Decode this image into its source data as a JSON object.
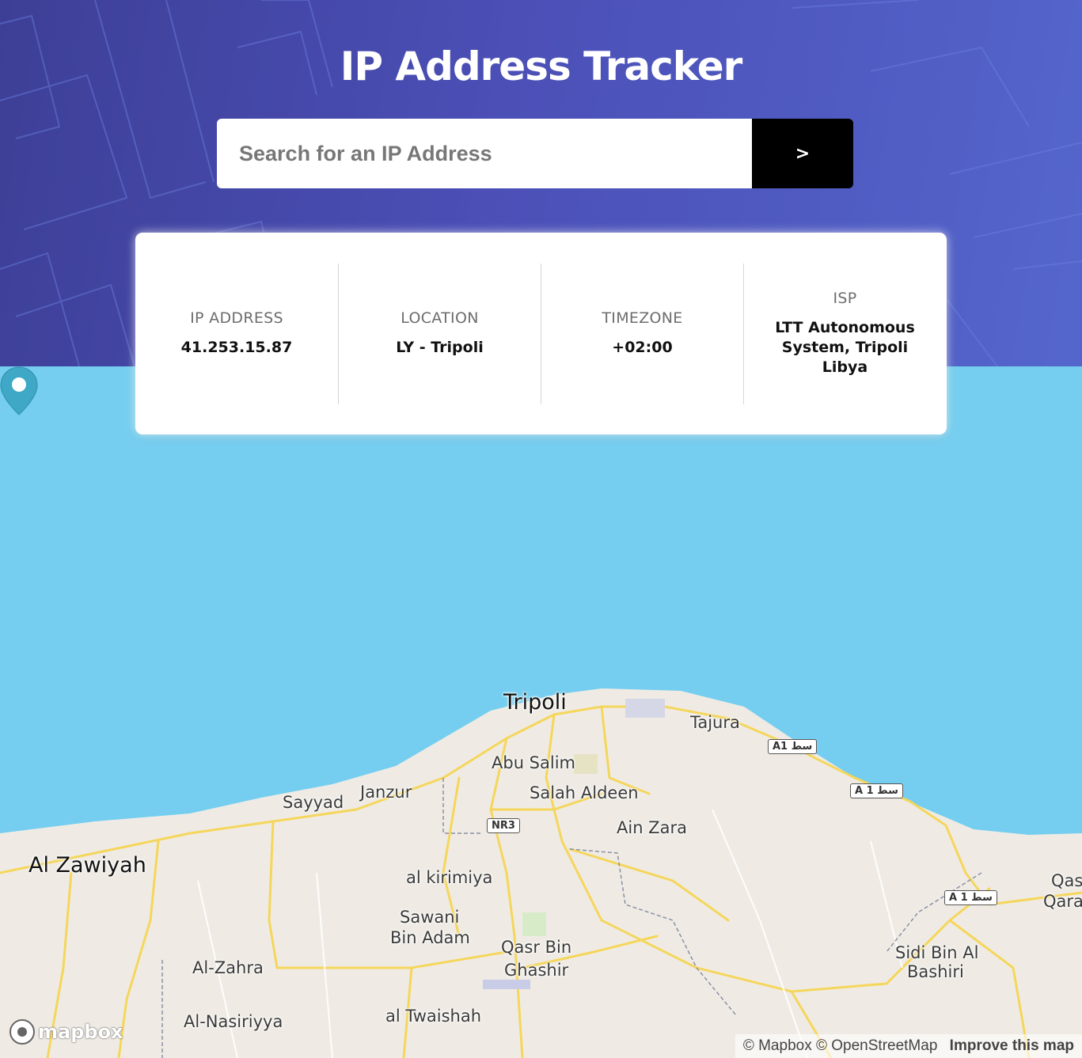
{
  "header": {
    "title": "IP Address Tracker",
    "search_placeholder": "Search for an IP Address",
    "submit_label": ">"
  },
  "stats": {
    "ip": {
      "label": "IP ADDRESS",
      "value": "41.253.15.87"
    },
    "location": {
      "label": "LOCATION",
      "value": "LY - Tripoli"
    },
    "timezone": {
      "label": "TIMEZONE",
      "value": "+02:00"
    },
    "isp": {
      "label": "ISP",
      "value": "LTT Autonomous System, Tripoli Libya"
    }
  },
  "map": {
    "places": {
      "tripoli": "Tripoli",
      "tajura": "Tajura",
      "abu_salim": "Abu Salim",
      "janzur": "Janzur",
      "sayyad": "Sayyad",
      "salah_aldeen": "Salah Aldeen",
      "ain_zara": "Ain Zara",
      "al_zawiyah": "Al Zawiyah",
      "al_kirimiya": "al kirimiya",
      "sawani": "Sawani",
      "bin_adam": "Bin Adam",
      "qasr_bin": "Qasr Bin",
      "ghashir": "Ghashir",
      "al_zahra": "Al-Zahra",
      "al_nasiriyya": "Al-Nasiriyya",
      "al_twaishah": "al Twaishah",
      "sidi_bin_al": "Sidi Bin Al",
      "bashiri": "Bashiri",
      "qas": "Qas",
      "qara": "Qara"
    },
    "roads": {
      "a1_1": "A1 سط",
      "a1_2": "A 1 سط",
      "a1_3": "A 1 سط",
      "nr3": "NR3"
    },
    "logo": "mapbox",
    "attribution": "© Mapbox © OpenStreetMap",
    "improve": "Improve this map",
    "colors": {
      "water": "#75cef0",
      "land": "#efebe4",
      "road": "#f5d65c",
      "marker": "#3fa8c6"
    }
  }
}
